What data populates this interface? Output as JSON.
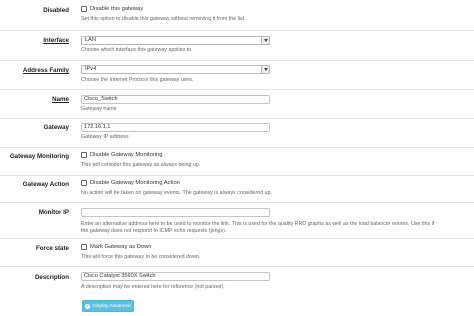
{
  "disabled": {
    "label": "Disabled",
    "checkbox_label": "Disable this gateway",
    "help": "Set this option to disable this gateway without removing it from the list."
  },
  "interface": {
    "label": "Interface",
    "value": "LAN",
    "help": "Choose which interface this gateway applies to."
  },
  "address_family": {
    "label": "Address Family",
    "value": "IPv4",
    "help": "Choose the Internet Protocol this gateway uses."
  },
  "name": {
    "label": "Name",
    "value": "Cisco_Switch",
    "help": "Gateway name"
  },
  "gateway": {
    "label": "Gateway",
    "value": "172.16.1.1",
    "help": "Gateway IP address"
  },
  "gateway_monitoring": {
    "label": "Gateway Monitoring",
    "checkbox_label": "Disable Gateway Monitoring",
    "help": "This will consider this gateway as always being up."
  },
  "gateway_action": {
    "label": "Gateway Action",
    "checkbox_label": "Disable Gateway Monitoring Action",
    "help": "No action will be taken on gateway events. The gateway is always considered up."
  },
  "monitor_ip": {
    "label": "Monitor IP",
    "value": "",
    "help_line1": "Enter an alternative address here to be used to monitor the link. This is used for the quality RRD graphs as well as the load balancer entries. Use this if",
    "help_line2": "the gateway does not respond to ICMP echo requests (pings)."
  },
  "force_state": {
    "label": "Force state",
    "checkbox_label": "Mark Gateway as Down",
    "help": "This will force this gateway to be considered down."
  },
  "description": {
    "label": "Description",
    "value": "Cisco Catalyst 3560X Switch",
    "help": "A description may be entered here for reference (not parsed)."
  },
  "display_advanced": {
    "label": "Display Advanced"
  }
}
